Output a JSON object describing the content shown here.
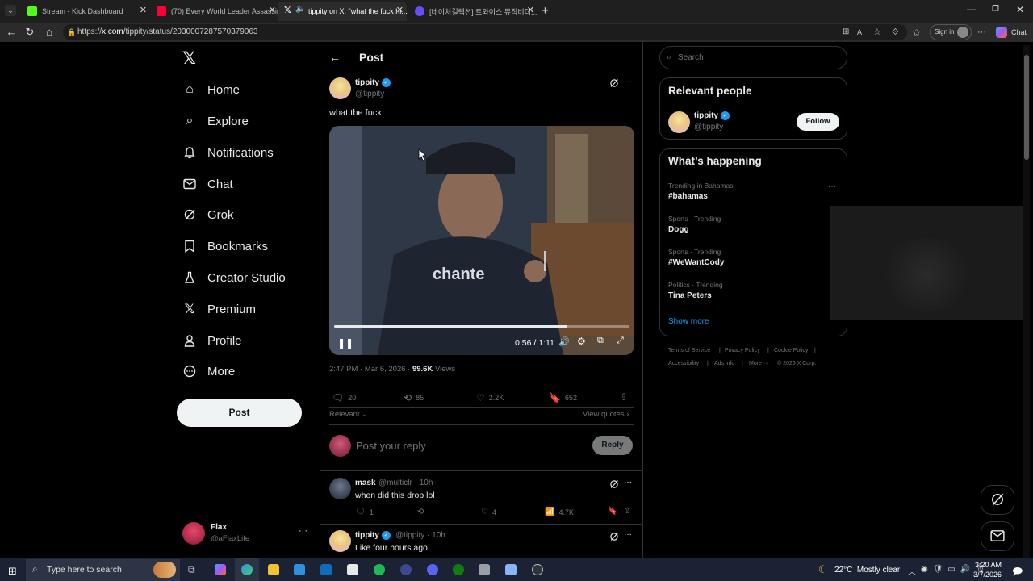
{
  "browser": {
    "tabs": [
      {
        "title": "Stream - Kick Dashboard",
        "color": "#53fc18"
      },
      {
        "title": "(70) Every World Leader Assassin...",
        "color": "#ff0033"
      },
      {
        "title": "tippity on X: \"what the fuck hi...",
        "color": "#ffffff"
      },
      {
        "title": "[네이처컬렉션] 트와이스 뮤직비디...",
        "color": "#6a4cff"
      }
    ],
    "url_prefix": "https://",
    "url_domain": "x.com",
    "url_path": "/tippity/status/2030007287570379063",
    "sign_in": "Sign in",
    "chat": "Chat"
  },
  "nav": {
    "items": [
      {
        "label": "Home",
        "icon": "home-icon"
      },
      {
        "label": "Explore",
        "icon": "search-icon"
      },
      {
        "label": "Notifications",
        "icon": "bell-icon"
      },
      {
        "label": "Chat",
        "icon": "mail-icon"
      },
      {
        "label": "Grok",
        "icon": "grok-icon"
      },
      {
        "label": "Bookmarks",
        "icon": "bookmark-icon"
      },
      {
        "label": "Creator Studio",
        "icon": "flask-icon"
      },
      {
        "label": "Premium",
        "icon": "x-icon"
      },
      {
        "label": "Profile",
        "icon": "person-icon"
      },
      {
        "label": "More",
        "icon": "more-circle-icon"
      }
    ],
    "post_button": "Post",
    "account": {
      "name": "Flax",
      "handle": "@aFlaxLife"
    }
  },
  "header": {
    "title": "Post"
  },
  "post": {
    "author": "tippity",
    "handle": "@tippity",
    "text": "what the fuck",
    "video_time": "0:56 / 1:11",
    "video_progress": 0.79,
    "time": "2:47 PM · Mar 6, 2026 · ",
    "views_count": "99.6K",
    "views_label": " Views",
    "replies": "20",
    "reposts": "85",
    "likes": "2.2K",
    "bookmarks": "652",
    "sort": "Relevant",
    "view_quotes": "View quotes"
  },
  "reply_box": {
    "placeholder": "Post your reply",
    "button": "Reply"
  },
  "replies": [
    {
      "author": "mask",
      "handle": "@multiclr",
      "age": "· 10h",
      "text": "when did this drop lol",
      "replies": "1",
      "reposts": "",
      "likes": "4",
      "views": "4.7K"
    },
    {
      "author": "tippity",
      "handle": "@tippity",
      "age": "· 10h",
      "text": "Like four hours ago"
    }
  ],
  "right": {
    "search_placeholder": "Search",
    "relevant_title": "Relevant people",
    "person": {
      "name": "tippity",
      "handle": "@tippity",
      "follow": "Follow"
    },
    "happening_title": "What’s happening",
    "trends": [
      {
        "meta": "Trending in Bahamas",
        "name": "#bahamas"
      },
      {
        "meta": "Sports · Trending",
        "name": "Dogg"
      },
      {
        "meta": "Sports · Trending",
        "name": "#WeWantCody"
      },
      {
        "meta": "Politics · Trending",
        "name": "Tina Peters"
      }
    ],
    "show_more": "Show more",
    "footer": [
      "Terms of Service",
      "|",
      "Privacy Policy",
      "|",
      "Cookie Policy",
      "|",
      "Accessibility",
      "|",
      "Ads info",
      "|",
      "More ···",
      "© 2026 X Corp."
    ]
  },
  "taskbar": {
    "search_placeholder": "Type here to search",
    "weather": "22°C  Mostly clear",
    "time": "3:20 AM",
    "date": "3/7/2026"
  },
  "colors": {
    "accent": "#1d9bf0",
    "bg": "#000000",
    "border": "#2f3336",
    "muted": "#71767b"
  }
}
